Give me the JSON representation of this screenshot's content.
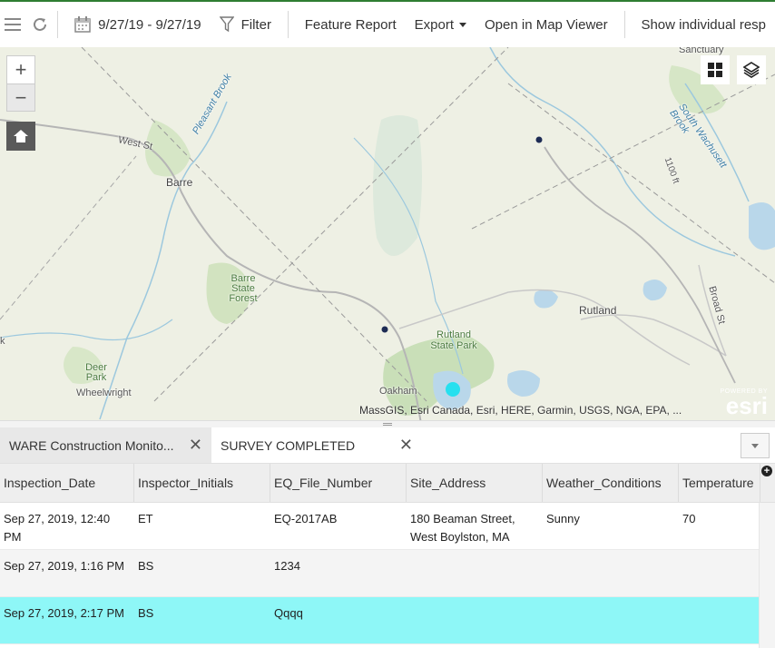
{
  "toolbar": {
    "date_range": "9/27/19 - 9/27/19",
    "filter_label": "Filter",
    "feature_report_label": "Feature Report",
    "export_label": "Export",
    "open_map_viewer_label": "Open in Map Viewer",
    "show_individual_label": "Show individual resp"
  },
  "map": {
    "labels": {
      "sanctuary": "Sanctuary",
      "pleasant_brook": "Pleasant Brook",
      "west_st": "West St",
      "barre": "Barre",
      "south_wachusett_brook": "South Wachusett Brook",
      "contour_100ft": "1100 ft",
      "barre_state_forest": "Barre State Forest",
      "rutland": "Rutland",
      "broad_st": "Broad St",
      "rutland_state_park": "Rutland State Park",
      "deer_park": "Deer Park",
      "wheelwright": "Wheelwright",
      "oakham": "Oakham",
      "k_edge": "k"
    },
    "attribution": "MassGIS, Esri Canada, Esri, HERE, Garmin, USGS, NGA, EPA, ...",
    "esri_powered_by": "POWERED BY",
    "esri_name": "esri",
    "zoom_in": "+",
    "zoom_out": "−"
  },
  "tabs": [
    {
      "label": "WARE Construction Monito...",
      "close": "✕"
    },
    {
      "label": "SURVEY COMPLETED",
      "close": "✕"
    }
  ],
  "table": {
    "columns": [
      "Inspection_Date",
      "Inspector_Initials",
      "EQ_File_Number",
      "Site_Address",
      "Weather_Conditions",
      "Temperature"
    ],
    "rows": [
      [
        "Sep 27, 2019, 12:40 PM",
        "ET",
        "EQ-2017AB",
        "180 Beaman Street, West Boylston, MA",
        "Sunny",
        "70"
      ],
      [
        "Sep 27, 2019, 1:16 PM",
        "BS",
        "1234",
        "",
        "",
        ""
      ],
      [
        "Sep 27, 2019, 2:17 PM",
        "BS",
        "Qqqq",
        "",
        "",
        ""
      ]
    ],
    "add_column": "+"
  },
  "colors": {
    "selected_row": "#8ef7f7",
    "feature_point": "#26e0ef",
    "map_bg": "#eef0e4"
  }
}
